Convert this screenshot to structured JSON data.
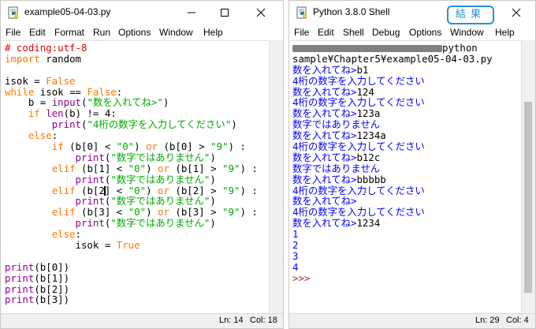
{
  "editor": {
    "title": "example05-04-03.py",
    "menus": [
      "File",
      "Edit",
      "Format",
      "Run",
      "Options",
      "Window",
      "Help"
    ],
    "code_lines": [
      [
        [
          "cm",
          "# coding:utf-8"
        ]
      ],
      [
        [
          "kw",
          "import"
        ],
        [
          "",
          " random"
        ]
      ],
      [
        [
          "",
          ""
        ]
      ],
      [
        [
          "",
          "isok = "
        ],
        [
          "kw",
          "False"
        ]
      ],
      [
        [
          "kw",
          "while"
        ],
        [
          "",
          " isok == "
        ],
        [
          "kw",
          "False"
        ],
        [
          "",
          ":"
        ]
      ],
      [
        [
          "",
          "    b = "
        ],
        [
          "bi",
          "input"
        ],
        [
          "",
          "("
        ],
        [
          "st",
          "\"数を入れてね>\""
        ],
        [
          "",
          ")"
        ]
      ],
      [
        [
          "",
          "    "
        ],
        [
          "kw",
          "if"
        ],
        [
          "",
          " "
        ],
        [
          "bi",
          "len"
        ],
        [
          "",
          "(b) != 4:"
        ]
      ],
      [
        [
          "",
          "        "
        ],
        [
          "bi",
          "print"
        ],
        [
          "",
          "("
        ],
        [
          "st",
          "\"4桁の数字を入力してください\""
        ],
        [
          "",
          ")"
        ]
      ],
      [
        [
          "",
          "    "
        ],
        [
          "kw",
          "else"
        ],
        [
          "",
          ":"
        ]
      ],
      [
        [
          "",
          "        "
        ],
        [
          "kw",
          "if"
        ],
        [
          "",
          " (b[0] < "
        ],
        [
          "st",
          "\"0\""
        ],
        [
          "",
          ") "
        ],
        [
          "kw",
          "or"
        ],
        [
          "",
          " (b[0] > "
        ],
        [
          "st",
          "\"9\""
        ],
        [
          "",
          ") :"
        ]
      ],
      [
        [
          "",
          "            "
        ],
        [
          "bi",
          "print"
        ],
        [
          "",
          "("
        ],
        [
          "st",
          "\"数字ではありません\""
        ],
        [
          "",
          ")"
        ]
      ],
      [
        [
          "",
          "        "
        ],
        [
          "kw",
          "elif"
        ],
        [
          "",
          " (b[1] < "
        ],
        [
          "st",
          "\"0\""
        ],
        [
          "",
          ") "
        ],
        [
          "kw",
          "or"
        ],
        [
          "",
          " (b[1] > "
        ],
        [
          "st",
          "\"9\""
        ],
        [
          "",
          ") :"
        ]
      ],
      [
        [
          "",
          "            "
        ],
        [
          "bi",
          "print"
        ],
        [
          "",
          "("
        ],
        [
          "st",
          "\"数字ではありません\""
        ],
        [
          "",
          ")"
        ]
      ],
      [
        [
          "",
          "        "
        ],
        [
          "kw",
          "elif"
        ],
        [
          "",
          " (b[2"
        ],
        [
          "cursor",
          ""
        ],
        [
          "",
          "] < "
        ],
        [
          "st",
          "\"0\""
        ],
        [
          "",
          ") "
        ],
        [
          "kw",
          "or"
        ],
        [
          "",
          " (b[2] > "
        ],
        [
          "st",
          "\"9\""
        ],
        [
          "",
          ") :"
        ]
      ],
      [
        [
          "",
          "            "
        ],
        [
          "bi",
          "print"
        ],
        [
          "",
          "("
        ],
        [
          "st",
          "\"数字ではありません\""
        ],
        [
          "",
          ")"
        ]
      ],
      [
        [
          "",
          "        "
        ],
        [
          "kw",
          "elif"
        ],
        [
          "",
          " (b[3] < "
        ],
        [
          "st",
          "\"0\""
        ],
        [
          "",
          ") "
        ],
        [
          "kw",
          "or"
        ],
        [
          "",
          " (b[3] > "
        ],
        [
          "st",
          "\"9\""
        ],
        [
          "",
          ") :"
        ]
      ],
      [
        [
          "",
          "            "
        ],
        [
          "bi",
          "print"
        ],
        [
          "",
          "("
        ],
        [
          "st",
          "\"数字ではありません\""
        ],
        [
          "",
          ")"
        ]
      ],
      [
        [
          "",
          "        "
        ],
        [
          "kw",
          "else"
        ],
        [
          "",
          ":"
        ]
      ],
      [
        [
          "",
          "            isok = "
        ],
        [
          "kw",
          "True"
        ]
      ],
      [
        [
          "",
          ""
        ]
      ],
      [
        [
          "bi",
          "print"
        ],
        [
          "",
          "(b[0])"
        ]
      ],
      [
        [
          "bi",
          "print"
        ],
        [
          "",
          "(b[1])"
        ]
      ],
      [
        [
          "bi",
          "print"
        ],
        [
          "",
          "(b[2])"
        ]
      ],
      [
        [
          "bi",
          "print"
        ],
        [
          "",
          "(b[3])"
        ]
      ]
    ],
    "status": {
      "ln": "Ln: 14",
      "col": "Col: 18"
    }
  },
  "shell": {
    "title": "Python 3.8.0 Shell",
    "menus": [
      "File",
      "Edit",
      "Shell",
      "Debug",
      "Options",
      "Window",
      "Help"
    ],
    "lines": [
      [
        [
          "redact",
          ""
        ],
        [
          "inp",
          "python"
        ]
      ],
      [
        [
          "inp",
          "sample¥Chapter5¥example05-04-03.py"
        ]
      ],
      [
        [
          "out",
          "数を入れてね>"
        ],
        [
          "inp",
          "b1"
        ]
      ],
      [
        [
          "out",
          "4桁の数字を入力してください"
        ]
      ],
      [
        [
          "out",
          "数を入れてね>"
        ],
        [
          "inp",
          "124"
        ]
      ],
      [
        [
          "out",
          "4桁の数字を入力してください"
        ]
      ],
      [
        [
          "out",
          "数を入れてね>"
        ],
        [
          "inp",
          "123a"
        ]
      ],
      [
        [
          "out",
          "数字ではありません"
        ]
      ],
      [
        [
          "out",
          "数を入れてね>"
        ],
        [
          "inp",
          "1234a"
        ]
      ],
      [
        [
          "out",
          "4桁の数字を入力してください"
        ]
      ],
      [
        [
          "out",
          "数を入れてね>"
        ],
        [
          "inp",
          "b12c"
        ]
      ],
      [
        [
          "out",
          "数字ではありません"
        ]
      ],
      [
        [
          "out",
          "数を入れてね>"
        ],
        [
          "inp",
          "bbbbb"
        ]
      ],
      [
        [
          "out",
          "4桁の数字を入力してください"
        ]
      ],
      [
        [
          "out",
          "数を入れてね>"
        ]
      ],
      [
        [
          "out",
          "4桁の数字を入力してください"
        ]
      ],
      [
        [
          "out",
          "数を入れてね>"
        ],
        [
          "inp",
          "1234"
        ]
      ],
      [
        [
          "out",
          "1"
        ]
      ],
      [
        [
          "out",
          "2"
        ]
      ],
      [
        [
          "out",
          "3"
        ]
      ],
      [
        [
          "out",
          "4"
        ]
      ],
      [
        [
          "prm",
          ">>> "
        ]
      ]
    ],
    "status": {
      "ln": "Ln: 29",
      "col": "Col: 4"
    }
  },
  "annotation": {
    "label": "結果"
  },
  "colors": {
    "keyword": "#ff7700",
    "builtin": "#900090",
    "string": "#00aa00",
    "comment": "#dd0000",
    "shell_output": "#0000ff",
    "prompt": "#a52a2a",
    "annotation_border": "#2a8fd8"
  },
  "icons": {
    "app": "python-idle-icon",
    "minimize": "minimize-icon",
    "maximize": "maximize-icon",
    "close": "close-icon"
  }
}
